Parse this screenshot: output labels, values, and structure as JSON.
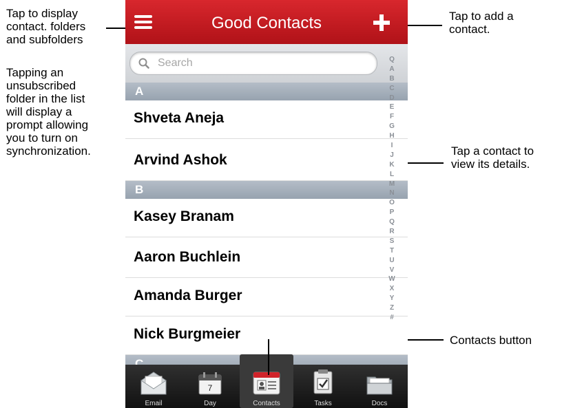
{
  "annotations": {
    "left_top": [
      "Tap to display",
      "contact. folders",
      "and subfolders"
    ],
    "left_mid": [
      "Tapping an",
      "unsubscribed",
      "folder in the list",
      "will display a",
      "prompt allowing",
      "you to turn on",
      "synchronization."
    ],
    "right_top": [
      "Tap to add a",
      "contact."
    ],
    "right_mid": [
      "Tap a contact to",
      "view its details."
    ],
    "right_bottom": "Contacts button"
  },
  "app": {
    "title": "Good Contacts",
    "accent_color": "#c41a20",
    "menu_icon": "hamburger-menu-icon",
    "add_icon": "plus-icon"
  },
  "search": {
    "placeholder": "Search"
  },
  "sections": [
    {
      "letter": "A",
      "contacts": [
        "Shveta Aneja",
        "Arvind Ashok"
      ]
    },
    {
      "letter": "B",
      "contacts": [
        "Kasey Branam",
        "Aaron Buchlein",
        "Amanda Burger",
        "Nick Burgmeier"
      ]
    },
    {
      "letter": "C",
      "contacts": []
    }
  ],
  "index_letters": [
    "Q",
    "A",
    "B",
    "C",
    "D",
    "E",
    "F",
    "G",
    "H",
    "I",
    "J",
    "K",
    "L",
    "M",
    "N",
    "O",
    "P",
    "Q",
    "R",
    "S",
    "T",
    "U",
    "V",
    "W",
    "X",
    "Y",
    "Z",
    "#"
  ],
  "tabs": [
    {
      "label": "Email",
      "icon": "email-icon",
      "selected": false
    },
    {
      "label": "Day",
      "icon": "calendar-day-icon",
      "day_number": "7",
      "selected": false
    },
    {
      "label": "Contacts",
      "icon": "contacts-card-icon",
      "selected": true
    },
    {
      "label": "Tasks",
      "icon": "tasks-checklist-icon",
      "selected": false
    },
    {
      "label": "Docs",
      "icon": "docs-folder-icon",
      "selected": false
    }
  ]
}
